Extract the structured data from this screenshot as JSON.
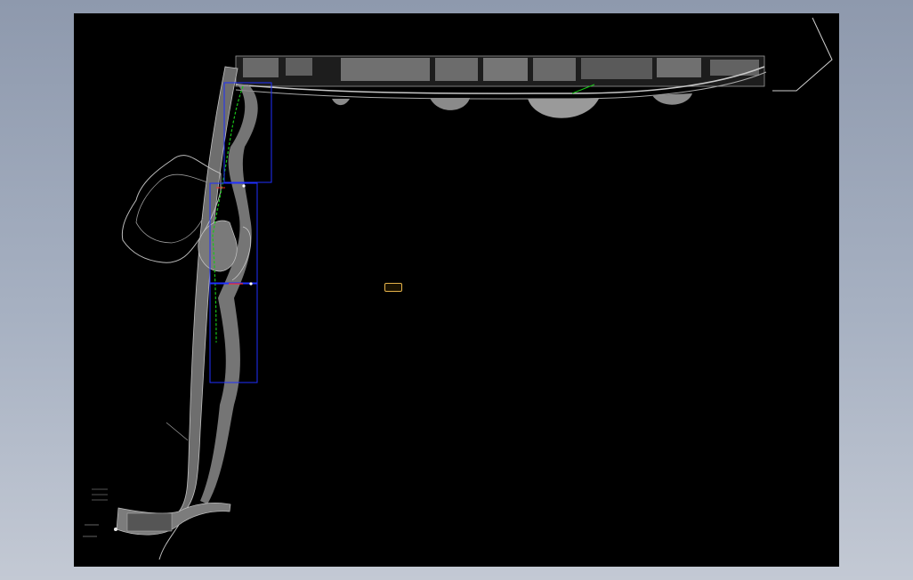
{
  "viewer": {
    "colors": {
      "background": "#000000",
      "drawing": "#bfbfbf",
      "frame": "#1f2fff",
      "path": "#18c418",
      "marker": "#ff2a2a",
      "chip": "#e6b34a"
    }
  }
}
